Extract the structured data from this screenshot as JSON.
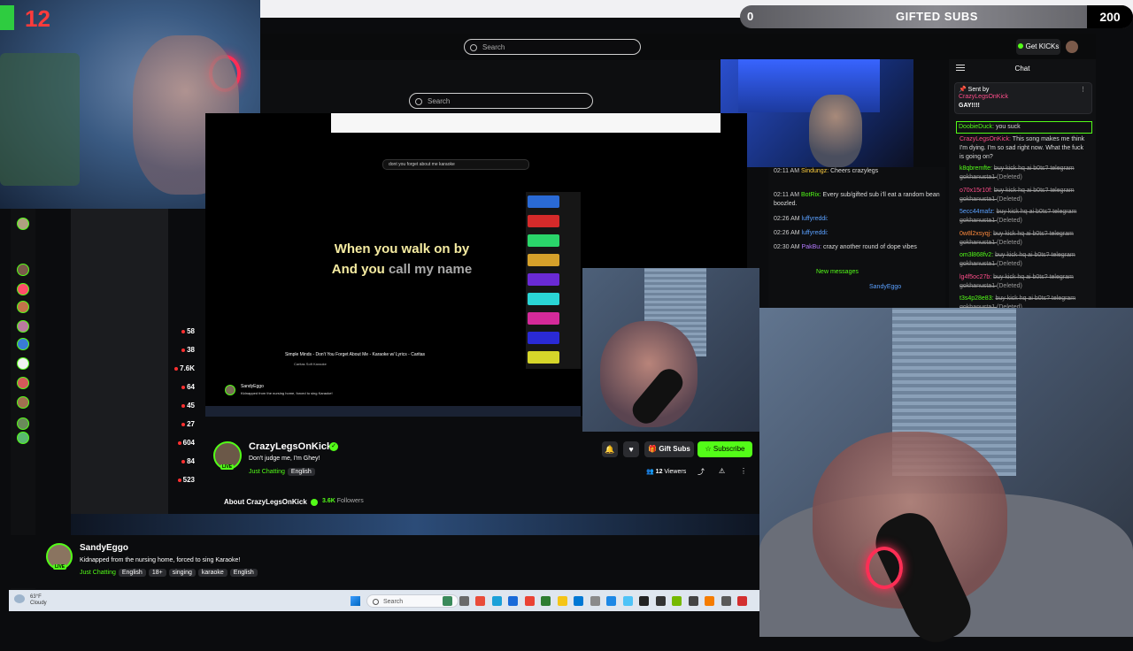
{
  "overlay": {
    "cam_counter": "12",
    "gifted_count": "0",
    "gifted_label": "GIFTED SUBS",
    "gifted_goal": "200"
  },
  "kick_header": {
    "search_placeholder": "Search",
    "get_kicks": "Get KICKs"
  },
  "mid_browser": {
    "search_placeholder": "Search",
    "gifted_label": "GIFTED SUBS"
  },
  "chat": {
    "title": "Chat",
    "pinned": {
      "label": "Sent by",
      "user": "CrazyLegsOnKick",
      "text": "GAY!!!!"
    },
    "messages": [
      {
        "user": "DoobieDuck:",
        "color": "uname-g",
        "text": "you suck"
      },
      {
        "user": "CrazyLegsOnKick:",
        "color": "uname-r",
        "text": "This song makes me think I'm dying. I'm so sad right now. What the fuck is going on?"
      },
      {
        "user": "k8qbremfte:",
        "color": "uname-g",
        "text": "buy kick hq ai b0ts? telegram gokhanusta1",
        "deleted": "(Deleted)"
      },
      {
        "user": "o70x15r10f:",
        "color": "uname-r",
        "text": "buy kick hq ai b0ts? telegram gokhanusta1",
        "deleted": "(Deleted)"
      },
      {
        "user": "5ecc44mafz:",
        "color": "uname-b",
        "text": "buy kick hq ai b0ts? telegram gokhanusta1",
        "deleted": "(Deleted)"
      },
      {
        "user": "0w8l2xsyqj:",
        "color": "uname-o",
        "text": "buy kick hq ai b0ts? telegram gokhanusta1",
        "deleted": "(Deleted)"
      },
      {
        "user": "om3l868fv2:",
        "color": "uname-g",
        "text": "buy kick hq ai b0ts? telegram gokhanusta1",
        "deleted": "(Deleted)"
      },
      {
        "user": "lg4f5oc27b:",
        "color": "uname-r",
        "text": "buy kick hq ai b0ts? telegram gokhanusta1",
        "deleted": "(Deleted)"
      },
      {
        "user": "t3s4p28e83:",
        "color": "uname-g",
        "text": "buy kick hq ai b0ts? telegram gokhanusta1",
        "deleted": "(Deleted)"
      }
    ]
  },
  "mid_chat": {
    "messages": [
      {
        "time": "02:11 AM",
        "user": "Sindungz:",
        "color": "uname-y",
        "text": "Cheers crazylegs"
      },
      {
        "time": "02:11 AM",
        "user": "BotRix:",
        "color": "uname-g",
        "text": "Every sub/gifted sub i'll eat a random bean boozled."
      },
      {
        "time": "02:26 AM",
        "user": "luffyreddi:",
        "color": "uname-b",
        "text": ""
      },
      {
        "time": "02:26 AM",
        "user": "luffyreddi:",
        "color": "uname-b",
        "text": ""
      },
      {
        "time": "02:30 AM",
        "user": "PakBu:",
        "color": "uname-p",
        "text": "crazy another round of dope vibes"
      }
    ],
    "new_messages": "New messages",
    "last_user": "SandyEggo"
  },
  "video": {
    "search_text": "dont you forget about me karaoke",
    "lyric_line1": "When you walk on by",
    "lyric_line2_bright": "And you",
    "lyric_line2_dim": " call my name",
    "title": "Simple Minds - Don't You Forget About Me - Karaoke w/ Lyrics - Caritas",
    "channel": "Caritas Soft Karaoke",
    "mini_channel": "SandyEggo",
    "mini_title": "Kidnapped from the nursing home, forced to sing Karaoke!"
  },
  "viewer_counts": [
    "58",
    "38",
    "7.6K",
    "64",
    "45",
    "27",
    "604",
    "84",
    "523"
  ],
  "channel": {
    "name": "CrazyLegsOnKick",
    "title": "Don't judge me, I'm Ghey!",
    "category": "Just Chatting",
    "tags": [
      "English"
    ],
    "gift_subs": "Gift Subs",
    "subscribe": "Subscribe",
    "viewers": "12",
    "viewers_label": "Viewers",
    "about": "About CrazyLegsOnKick",
    "followers": "3.6K",
    "followers_label": "Followers",
    "live": "LIVE"
  },
  "bottom_channel": {
    "name": "SandyEggo",
    "title": "Kidnapped from the nursing home, forced to sing Karaoke!",
    "category": "Just Chatting",
    "tags": [
      "English",
      "18+",
      "singing",
      "karaoke",
      "English"
    ],
    "live": "LIVE"
  },
  "taskbar": {
    "temp": "63°F",
    "condition": "Cloudy",
    "search": "Search"
  },
  "colors": {
    "kick_green": "#53fc18",
    "live_red": "#ff3030"
  }
}
